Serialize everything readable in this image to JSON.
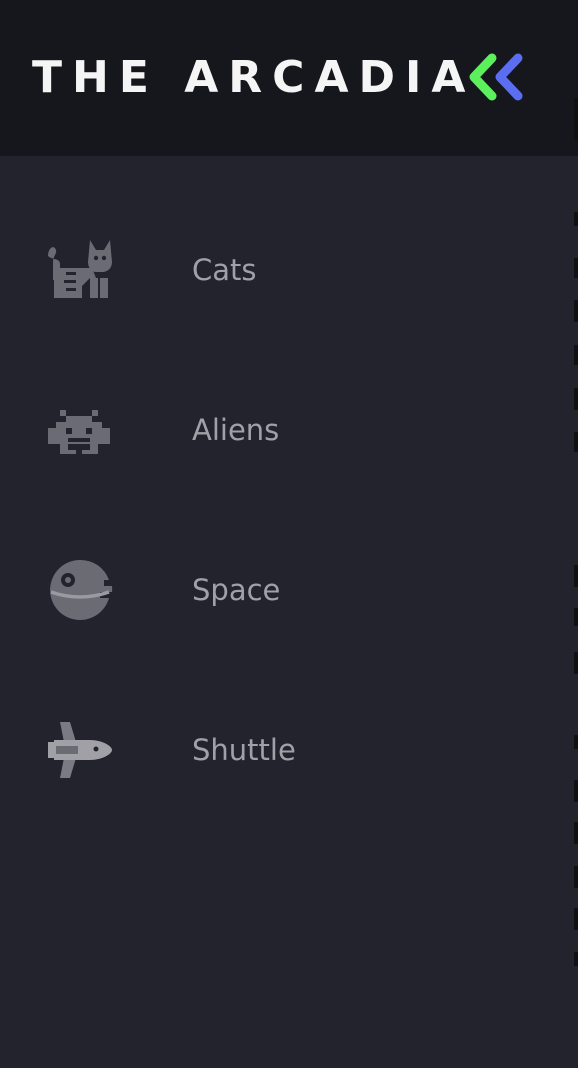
{
  "sidebar": {
    "logo": {
      "title": "THE ARCADIA",
      "toggle_icon": "double-chevron-left-icon"
    },
    "items": [
      {
        "label": "Cats",
        "icon": "cat-icon"
      },
      {
        "label": "Aliens",
        "icon": "space-invader-icon"
      },
      {
        "label": "Space",
        "icon": "death-star-icon"
      },
      {
        "label": "Shuttle",
        "icon": "space-shuttle-icon"
      }
    ]
  },
  "colors": {
    "sidebar_bg": "#23232e",
    "logo_bg": "#16161d",
    "text": "#a0a0a6",
    "icon": "#6b6b73",
    "chevron_green": "#5cf05c",
    "chevron_blue": "#5b6df0"
  }
}
